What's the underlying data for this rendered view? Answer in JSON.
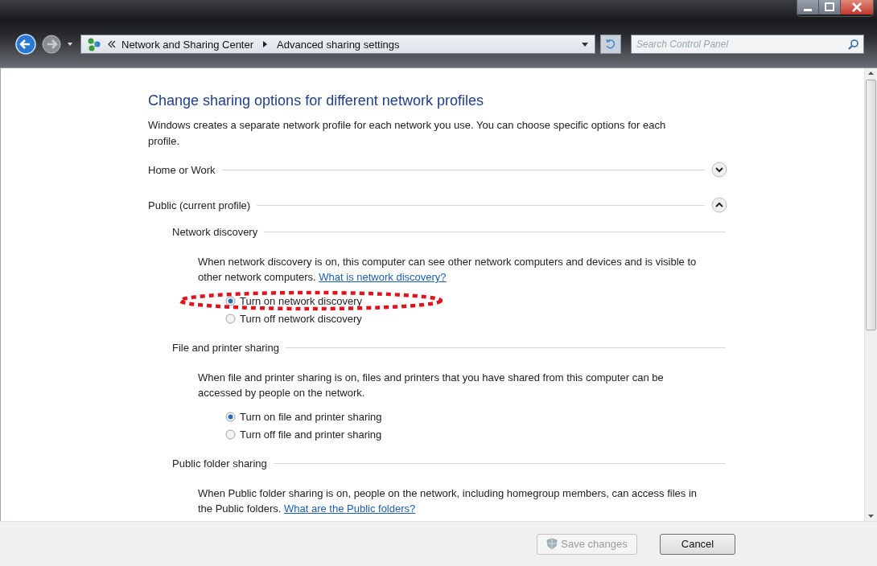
{
  "navigation": {
    "breadcrumb": [
      "Network and Sharing Center",
      "Advanced sharing settings"
    ],
    "search": {
      "placeholder": "Search Control Panel"
    }
  },
  "page": {
    "title": "Change sharing options for different network profiles",
    "description": "Windows creates a separate network profile for each network you use. You can choose specific options for each profile.",
    "profiles": [
      {
        "name": "Home or Work",
        "expanded": false
      },
      {
        "name": "Public (current profile)",
        "expanded": true,
        "sections": [
          {
            "heading": "Network discovery",
            "text": "When network discovery is on, this computer can see other network computers and devices and is visible to other network computers.",
            "link": "What is network discovery?",
            "options": [
              {
                "label": "Turn on network discovery",
                "selected": true,
                "highlighted": true
              },
              {
                "label": "Turn off network discovery",
                "selected": false,
                "highlighted": false
              }
            ]
          },
          {
            "heading": "File and printer sharing",
            "text": "When file and printer sharing is on, files and printers that you have shared from this computer can be accessed by people on the network.",
            "options": [
              {
                "label": "Turn on file and printer sharing",
                "selected": true,
                "highlighted": false
              },
              {
                "label": "Turn off file and printer sharing",
                "selected": false,
                "highlighted": false
              }
            ]
          },
          {
            "heading": "Public folder sharing",
            "text": "When Public folder sharing is on, people on the network, including homegroup members, can access files in the Public folders.",
            "link": "What are the Public folders?"
          }
        ]
      }
    ]
  },
  "buttons": [
    {
      "label": "Save changes",
      "kind": "admin",
      "disabled": true
    },
    {
      "label": "Cancel",
      "kind": "plain",
      "disabled": false
    }
  ]
}
